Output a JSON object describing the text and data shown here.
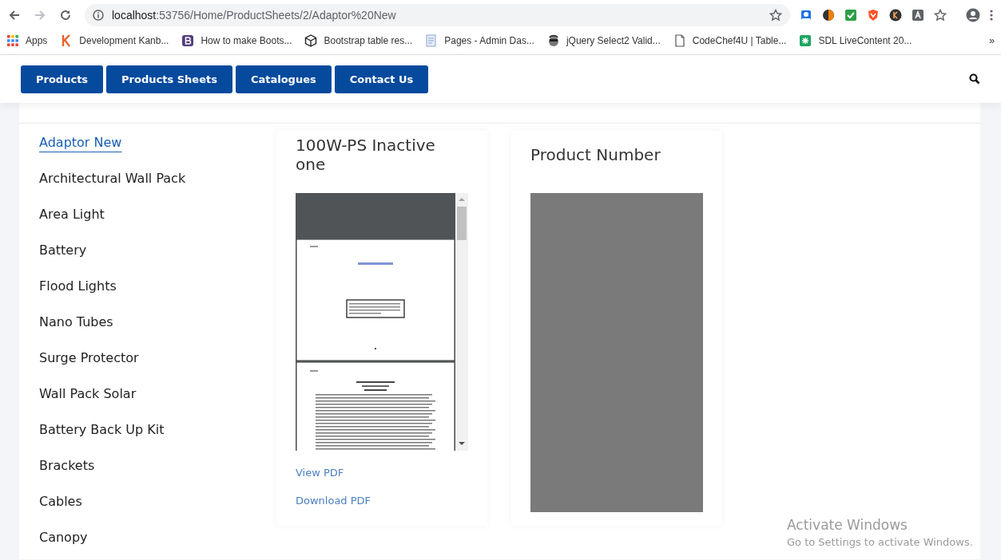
{
  "browser": {
    "url_host": "localhost",
    "url_path": ":53756/Home/ProductSheets/2/Adaptor%20New",
    "bookmarks": [
      {
        "label": "Apps"
      },
      {
        "label": "Development Kanb..."
      },
      {
        "label": "How to make Boots..."
      },
      {
        "label": "Bootstrap table res..."
      },
      {
        "label": "Pages - Admin Das..."
      },
      {
        "label": "jQuery Select2 Valid..."
      },
      {
        "label": "CodeChef4U | Table..."
      },
      {
        "label": "SDL LiveContent 20..."
      }
    ],
    "overflow": "»"
  },
  "nav": {
    "items": [
      {
        "label": "Products"
      },
      {
        "label": "Products Sheets"
      },
      {
        "label": "Catalogues"
      },
      {
        "label": "Contact Us"
      }
    ]
  },
  "sidebar": {
    "items": [
      {
        "label": "Adaptor New",
        "selected": true
      },
      {
        "label": "Architectural Wall Pack",
        "selected": false
      },
      {
        "label": "Area Light",
        "selected": false
      },
      {
        "label": "Battery",
        "selected": false
      },
      {
        "label": "Flood Lights",
        "selected": false
      },
      {
        "label": "Nano Tubes",
        "selected": false
      },
      {
        "label": "Surge Protector",
        "selected": false
      },
      {
        "label": "Wall Pack Solar",
        "selected": false
      },
      {
        "label": "Battery Back Up Kit",
        "selected": false
      },
      {
        "label": "Brackets",
        "selected": false
      },
      {
        "label": "Cables",
        "selected": false
      },
      {
        "label": "Canopy",
        "selected": false
      }
    ]
  },
  "sheets": [
    {
      "title": "100W-PS Inactive one",
      "kind": "pdf",
      "links": [
        "View PDF",
        "Download PDF"
      ]
    },
    {
      "title": "Product Number",
      "kind": "blank"
    }
  ],
  "os_notice": {
    "title": "Activate Windows",
    "subtitle": "Go to Settings to activate Windows."
  }
}
